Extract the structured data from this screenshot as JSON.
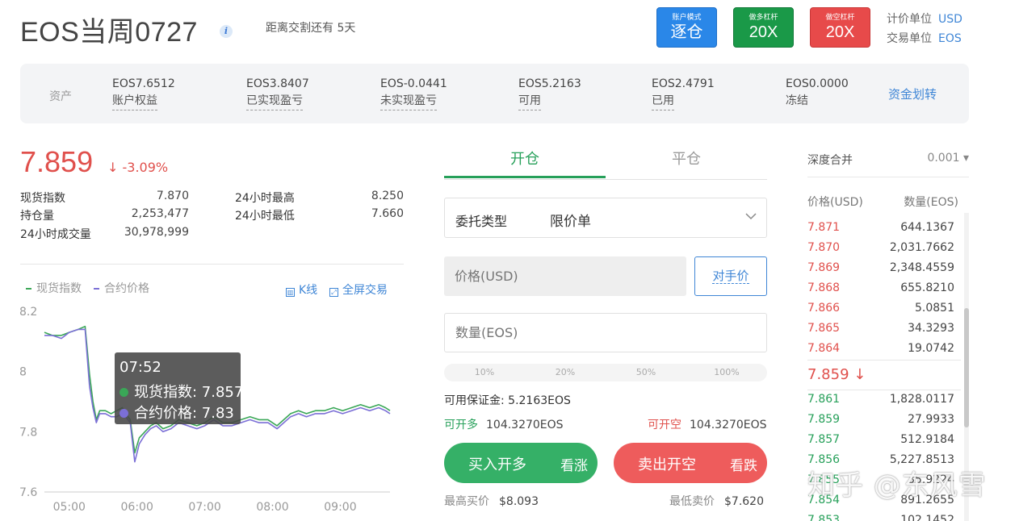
{
  "header": {
    "title": "EOS当周0727",
    "info_icon": "info-icon",
    "delivery_text": "距离交割还有 5天",
    "margin_mode": {
      "small": "账户模式",
      "big": "逐仓",
      "color": "#2a87e8"
    },
    "long_leverage": {
      "small": "做多杠杆",
      "big": "20X",
      "color": "#1a9948"
    },
    "short_leverage": {
      "small": "做空杠杆",
      "big": "20X",
      "color": "#e74a4a"
    },
    "pricing_unit_label": "计价单位",
    "pricing_unit_value": "USD",
    "trading_unit_label": "交易单位",
    "trading_unit_value": "EOS"
  },
  "assets": {
    "label": "资产",
    "items": [
      {
        "value": "EOS7.6512",
        "label": "账户权益"
      },
      {
        "value": "EOS3.8407",
        "label": "已实现盈亏"
      },
      {
        "value": "EOS-0.0441",
        "label": "未实现盈亏"
      },
      {
        "value": "EOS5.2163",
        "label": "可用"
      },
      {
        "value": "EOS2.4791",
        "label": "已用"
      },
      {
        "value": "EOS0.0000",
        "label": "冻结"
      }
    ],
    "transfer_link": "资金划转"
  },
  "market": {
    "last_price": "7.859",
    "change": "↓ -3.09%",
    "stats": [
      {
        "label": "现货指数",
        "value": "7.870"
      },
      {
        "label": "持仓量",
        "value": "2,253,477"
      },
      {
        "label": "24小时成交量",
        "value": "30,978,999"
      },
      {
        "label": "24小时最高",
        "value": "8.250"
      },
      {
        "label": "24小时最低",
        "value": "7.660"
      }
    ]
  },
  "chart_controls": {
    "legend_spot": "现货指数",
    "legend_contract": "合约价格",
    "kline_link": "K线",
    "fullscreen_link": "全屏交易"
  },
  "chart_data": {
    "type": "line",
    "x_ticks": [
      "05:00",
      "06:00",
      "07:00",
      "08:00",
      "09:00"
    ],
    "y_ticks": [
      "8.2",
      "8",
      "7.8",
      "7.6"
    ],
    "ylim": [
      7.6,
      8.2
    ],
    "x_range_minutes": [
      278,
      584
    ],
    "series": [
      {
        "name": "现货指数",
        "color": "#3aa757",
        "points": [
          [
            278,
            8.13
          ],
          [
            285,
            8.12
          ],
          [
            293,
            8.12
          ],
          [
            300,
            8.13
          ],
          [
            308,
            8.14
          ],
          [
            314,
            8.15
          ],
          [
            318,
            7.99
          ],
          [
            321,
            7.9
          ],
          [
            324,
            7.84
          ],
          [
            327,
            7.87
          ],
          [
            332,
            7.87
          ],
          [
            337,
            7.86
          ],
          [
            342,
            7.87
          ],
          [
            347,
            7.88
          ],
          [
            350,
            7.86
          ],
          [
            354,
            7.84
          ],
          [
            358,
            7.73
          ],
          [
            362,
            7.78
          ],
          [
            367,
            7.8
          ],
          [
            372,
            7.82
          ],
          [
            377,
            7.83
          ],
          [
            383,
            7.81
          ],
          [
            390,
            7.82
          ],
          [
            397,
            7.84
          ],
          [
            405,
            7.83
          ],
          [
            413,
            7.82
          ],
          [
            420,
            7.83
          ],
          [
            428,
            7.85
          ],
          [
            436,
            7.83
          ],
          [
            444,
            7.83
          ],
          [
            452,
            7.84
          ],
          [
            460,
            7.85
          ],
          [
            468,
            7.84
          ],
          [
            476,
            7.84
          ],
          [
            484,
            7.82
          ],
          [
            490,
            7.84
          ],
          [
            496,
            7.86
          ],
          [
            503,
            7.87
          ],
          [
            510,
            7.86
          ],
          [
            518,
            7.87
          ],
          [
            526,
            7.87
          ],
          [
            534,
            7.88
          ],
          [
            542,
            7.87
          ],
          [
            550,
            7.88
          ],
          [
            558,
            7.89
          ],
          [
            566,
            7.88
          ],
          [
            574,
            7.89
          ],
          [
            580,
            7.88
          ],
          [
            584,
            7.87
          ]
        ]
      },
      {
        "name": "合约价格",
        "color": "#7b6fd6",
        "points": [
          [
            278,
            8.12
          ],
          [
            285,
            8.12
          ],
          [
            293,
            8.11
          ],
          [
            300,
            8.13
          ],
          [
            308,
            8.14
          ],
          [
            314,
            8.14
          ],
          [
            318,
            7.95
          ],
          [
            321,
            7.88
          ],
          [
            324,
            7.83
          ],
          [
            327,
            7.86
          ],
          [
            332,
            7.86
          ],
          [
            337,
            7.85
          ],
          [
            342,
            7.85
          ],
          [
            347,
            7.86
          ],
          [
            350,
            7.85
          ],
          [
            354,
            7.83
          ],
          [
            358,
            7.7
          ],
          [
            362,
            7.76
          ],
          [
            367,
            7.79
          ],
          [
            372,
            7.81
          ],
          [
            377,
            7.82
          ],
          [
            383,
            7.8
          ],
          [
            390,
            7.81
          ],
          [
            397,
            7.83
          ],
          [
            405,
            7.82
          ],
          [
            413,
            7.81
          ],
          [
            420,
            7.82
          ],
          [
            428,
            7.84
          ],
          [
            436,
            7.82
          ],
          [
            444,
            7.82
          ],
          [
            452,
            7.83
          ],
          [
            460,
            7.84
          ],
          [
            468,
            7.83
          ],
          [
            476,
            7.83
          ],
          [
            484,
            7.81
          ],
          [
            490,
            7.83
          ],
          [
            496,
            7.85
          ],
          [
            503,
            7.86
          ],
          [
            510,
            7.85
          ],
          [
            518,
            7.86
          ],
          [
            526,
            7.86
          ],
          [
            534,
            7.87
          ],
          [
            542,
            7.86
          ],
          [
            550,
            7.87
          ],
          [
            558,
            7.88
          ],
          [
            566,
            7.87
          ],
          [
            574,
            7.88
          ],
          [
            580,
            7.87
          ],
          [
            584,
            7.86
          ]
        ]
      }
    ],
    "tooltip": {
      "time": "07:52",
      "spot_label": "现货指数: 7.857",
      "contract_label": "合约价格: 7.83"
    }
  },
  "order_form": {
    "tab_open": "开仓",
    "tab_close": "平仓",
    "order_type_label": "委托类型",
    "order_type_value": "限价单",
    "price_placeholder": "价格(USD)",
    "counterparty_button": "对手价",
    "quantity_placeholder": "数量(EOS)",
    "percentages": [
      "10%",
      "20%",
      "50%",
      "100%"
    ],
    "available_margin": "可用保证金: 5.2163EOS",
    "can_open_long_label": "可开多",
    "can_open_long_value": "104.3270EOS",
    "can_open_short_label": "可开空",
    "can_open_short_value": "104.3270EOS",
    "buy_button": {
      "main": "买入开多",
      "sub": "看涨"
    },
    "sell_button": {
      "main": "卖出开空",
      "sub": "看跌"
    },
    "max_buy_label": "最高买价",
    "max_buy_value": "$8.093",
    "min_sell_label": "最低卖价",
    "min_sell_value": "$7.620"
  },
  "order_book": {
    "depth_label": "深度合并",
    "depth_value": "0.001 ▾",
    "col_price": "价格(USD)",
    "col_qty": "数量(EOS)",
    "asks": [
      {
        "price": "7.871",
        "qty": "644.1367"
      },
      {
        "price": "7.870",
        "qty": "2,031.7662"
      },
      {
        "price": "7.869",
        "qty": "2,348.4559"
      },
      {
        "price": "7.868",
        "qty": "655.8210"
      },
      {
        "price": "7.866",
        "qty": "5.0851"
      },
      {
        "price": "7.865",
        "qty": "34.3293"
      },
      {
        "price": "7.864",
        "qty": "19.0742"
      }
    ],
    "mid_price": "7.859 ↓",
    "bids": [
      {
        "price": "7.861",
        "qty": "1,828.0117"
      },
      {
        "price": "7.859",
        "qty": "27.9933"
      },
      {
        "price": "7.857",
        "qty": "512.9184"
      },
      {
        "price": "7.856",
        "qty": "5,227.8513"
      },
      {
        "price": "7.855",
        "qty": "35.9224"
      },
      {
        "price": "7.854",
        "qty": "891.2655"
      },
      {
        "price": "7.853",
        "qty": "102.1452"
      }
    ]
  },
  "watermark": "知乎 @东风雪"
}
